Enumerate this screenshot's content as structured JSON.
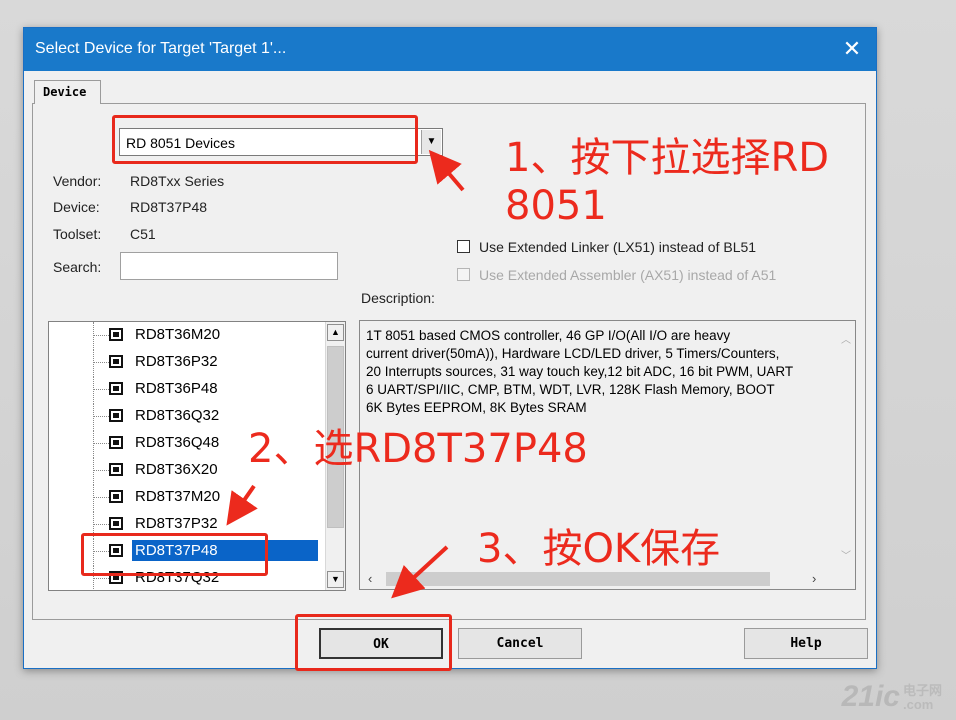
{
  "window": {
    "title": "Select Device for Target 'Target 1'...",
    "close_glyph": "✕"
  },
  "tab": {
    "label": "Device"
  },
  "database": {
    "value": "RD 8051 Devices"
  },
  "info": {
    "vendor_label": "Vendor:",
    "vendor_value": "RD8Txx Series",
    "device_label": "Device:",
    "device_value": "RD8T37P48",
    "toolset_label": "Toolset:",
    "toolset_value": "C51",
    "search_label": "Search:",
    "search_value": ""
  },
  "options": {
    "linker_label": "Use Extended Linker (LX51) instead of BL51",
    "linker_checked": false,
    "assembler_label": "Use Extended Assembler (AX51) instead of A51",
    "assembler_checked": false,
    "assembler_enabled": false
  },
  "device_list": {
    "items": [
      "RD8T36M20",
      "RD8T36P32",
      "RD8T36P48",
      "RD8T36Q32",
      "RD8T36Q48",
      "RD8T36X20",
      "RD8T37M20",
      "RD8T37P32",
      "RD8T37P48",
      "RD8T37Q32"
    ],
    "selected": "RD8T37P48"
  },
  "description": {
    "label": "Description:",
    "lines": [
      "1T 8051 based CMOS controller, 46 GP I/O(All I/O are heavy",
      "current driver(50mA)),  Hardware LCD/LED driver, 5 Timers/Counters,",
      "20 Interrupts sources, 31 way touch key,12 bit ADC, 16 bit PWM, UART",
      "6  UART/SPI/IIC, CMP, BTM, WDT, LVR, 128K Flash Memory, BOOT",
      "6K Bytes  EEPROM, 8K Bytes SRAM"
    ]
  },
  "buttons": {
    "ok": "OK",
    "cancel": "Cancel",
    "help": "Help"
  },
  "annotations": {
    "step1_line1": "1、按下拉选择RD",
    "step1_line2": "8051",
    "step2": "2、选RD8T37P48",
    "step3": "3、按OK保存",
    "color": "#ec2a1d"
  },
  "watermark": {
    "brand": "21ic",
    "line1": "电子网",
    "line2": ".com"
  }
}
